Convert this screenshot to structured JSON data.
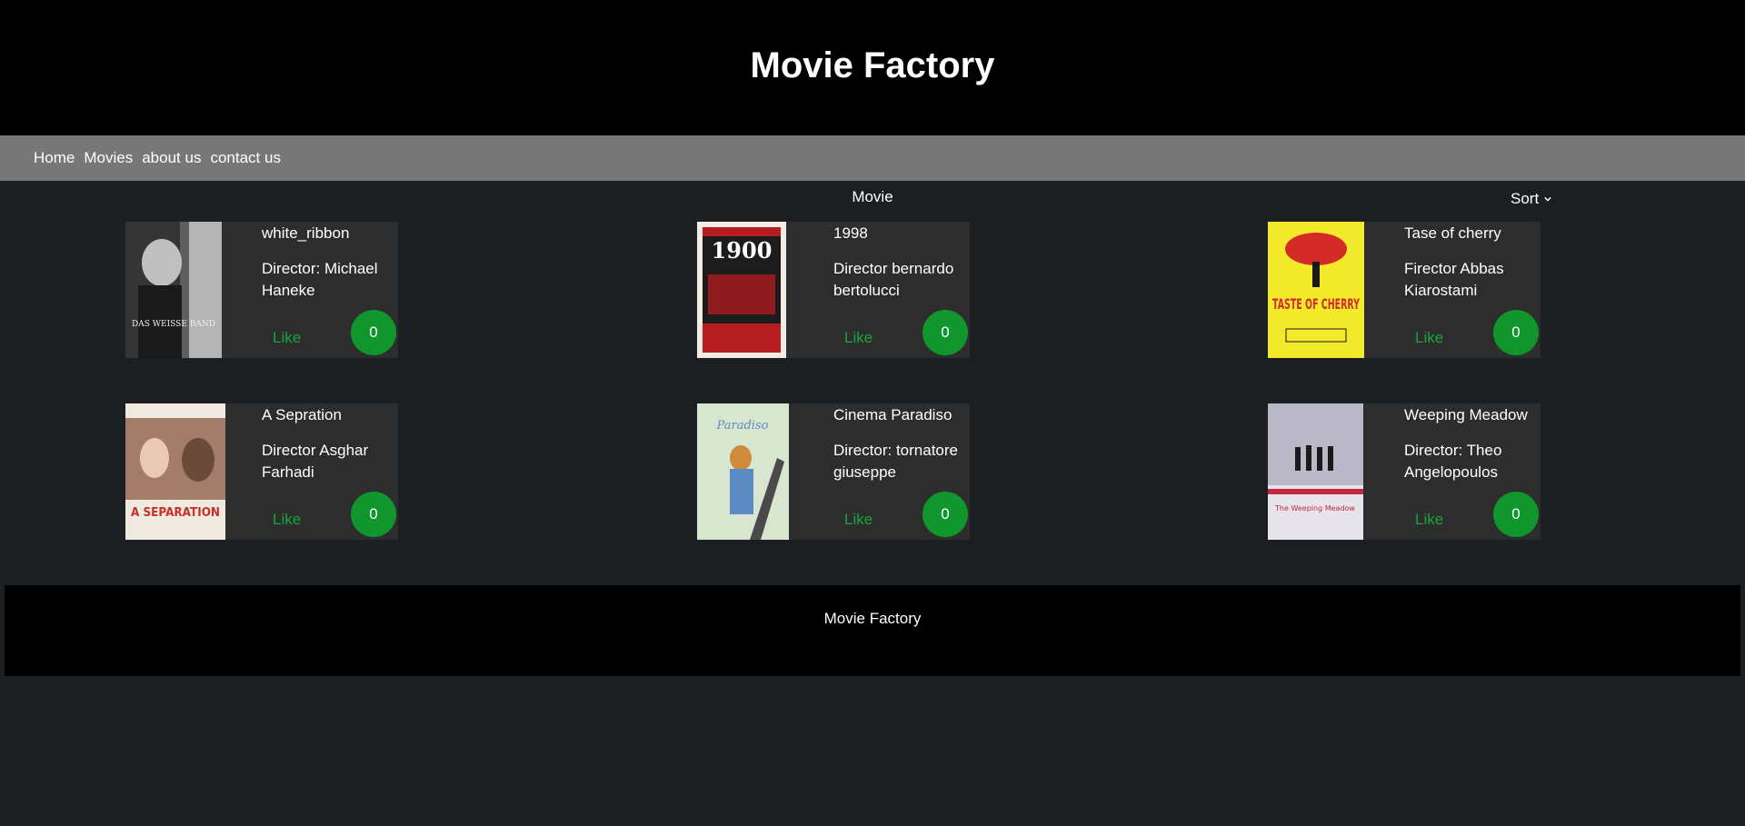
{
  "header": {
    "title": "Movie Factory"
  },
  "nav": {
    "items": [
      "Home",
      "Movies",
      "about us",
      "contact us"
    ]
  },
  "main": {
    "section_title": "Movie",
    "sort_label": "Sort"
  },
  "movies": [
    {
      "title": "white_ribbon",
      "director": "Director: Michael Haneke",
      "like_label": "Like",
      "likes": "0",
      "poster": {
        "colors": [
          "#d8d8d8",
          "#5e5e5e",
          "#1a1a1a"
        ],
        "caption": "DAS WEISSE BAND"
      }
    },
    {
      "title": "1998",
      "director": "Director bernardo bertolucci",
      "like_label": "Like",
      "likes": "0",
      "poster": {
        "colors": [
          "#f2ece4",
          "#b51d22",
          "#1c1c1c"
        ],
        "caption": "1900"
      }
    },
    {
      "title": "Tase of cherry",
      "director": "Firector Abbas Kiarostami",
      "like_label": "Like",
      "likes": "0",
      "poster": {
        "colors": [
          "#f4ea2c",
          "#d42a28",
          "#1a1a1a"
        ],
        "caption": "TASTE OF CHERRY"
      }
    },
    {
      "title": "A Sepration",
      "director": "Director Asghar Farhadi",
      "like_label": "Like",
      "likes": "0",
      "poster": {
        "colors": [
          "#efe9e0",
          "#a47c6a",
          "#c6302a"
        ],
        "caption": "A SEPARATION"
      }
    },
    {
      "title": "Cinema Paradiso",
      "director": "Director: tornatore giuseppe",
      "like_label": "Like",
      "likes": "0",
      "poster": {
        "colors": [
          "#d8e6cf",
          "#5c8ac5",
          "#cf8a3a"
        ],
        "caption": "Paradiso"
      }
    },
    {
      "title": "Weeping Meadow",
      "director": "Director: Theo Angelopoulos",
      "like_label": "Like",
      "likes": "0",
      "poster": {
        "colors": [
          "#e7e4ec",
          "#8d8aa0",
          "#c3283c"
        ],
        "caption": "The Weeping Meadow"
      }
    }
  ],
  "footer": {
    "text": "Movie Factory"
  },
  "colors": {
    "header_bg": "#000000",
    "nav_bg": "#777777",
    "page_bg": "#1b1f22",
    "card_bg": "#2d2d2d",
    "accent_green": "#11962d"
  }
}
